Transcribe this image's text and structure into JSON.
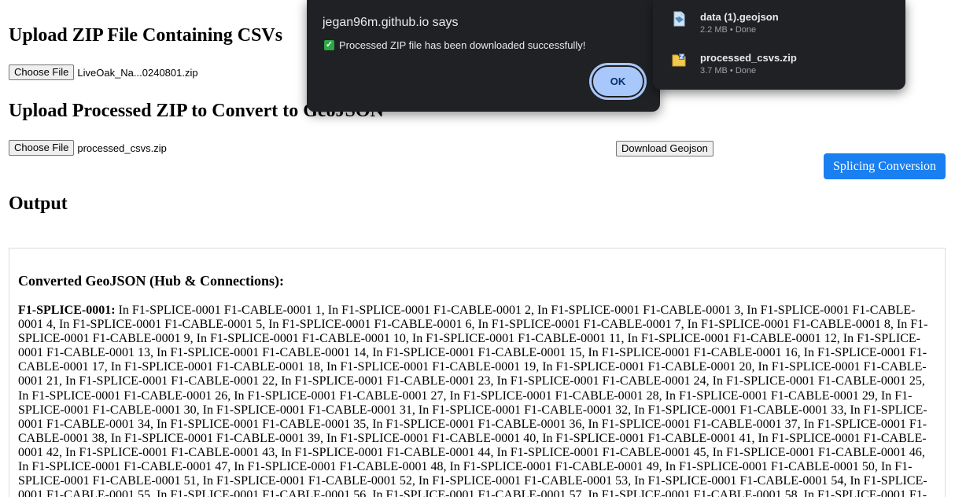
{
  "main": {
    "upload_heading": "Upload ZIP File Containing CSVs",
    "upload_choose_label": "Choose File",
    "upload_file_name": "LiveOak_Na...0240801.zip",
    "processed_heading": "Upload Processed ZIP to Convert to GeoJSON",
    "processed_choose_label": "Choose File",
    "processed_file_name": "processed_csvs.zip",
    "download_geojson_label": "Download Geojson",
    "splicing_label": "Splicing Conversion",
    "output_heading": "Output"
  },
  "output": {
    "title": "Converted GeoJSON (Hub & Connections):",
    "hub_label": "F1-SPLICE-0001:",
    "connections_text": " In F1-SPLICE-0001 F1-CABLE-0001 1, In F1-SPLICE-0001 F1-CABLE-0001 2, In F1-SPLICE-0001 F1-CABLE-0001 3, In F1-SPLICE-0001 F1-CABLE-0001 4, In F1-SPLICE-0001 F1-CABLE-0001 5, In F1-SPLICE-0001 F1-CABLE-0001 6, In F1-SPLICE-0001 F1-CABLE-0001 7, In F1-SPLICE-0001 F1-CABLE-0001 8, In F1-SPLICE-0001 F1-CABLE-0001 9, In F1-SPLICE-0001 F1-CABLE-0001 10, In F1-SPLICE-0001 F1-CABLE-0001 11, In F1-SPLICE-0001 F1-CABLE-0001 12, In F1-SPLICE-0001 F1-CABLE-0001 13, In F1-SPLICE-0001 F1-CABLE-0001 14, In F1-SPLICE-0001 F1-CABLE-0001 15, In F1-SPLICE-0001 F1-CABLE-0001 16, In F1-SPLICE-0001 F1-CABLE-0001 17, In F1-SPLICE-0001 F1-CABLE-0001 18, In F1-SPLICE-0001 F1-CABLE-0001 19, In F1-SPLICE-0001 F1-CABLE-0001 20, In F1-SPLICE-0001 F1-CABLE-0001 21, In F1-SPLICE-0001 F1-CABLE-0001 22, In F1-SPLICE-0001 F1-CABLE-0001 23, In F1-SPLICE-0001 F1-CABLE-0001 24, In F1-SPLICE-0001 F1-CABLE-0001 25, In F1-SPLICE-0001 F1-CABLE-0001 26, In F1-SPLICE-0001 F1-CABLE-0001 27, In F1-SPLICE-0001 F1-CABLE-0001 28, In F1-SPLICE-0001 F1-CABLE-0001 29, In F1-SPLICE-0001 F1-CABLE-0001 30, In F1-SPLICE-0001 F1-CABLE-0001 31, In F1-SPLICE-0001 F1-CABLE-0001 32, In F1-SPLICE-0001 F1-CABLE-0001 33, In F1-SPLICE-0001 F1-CABLE-0001 34, In F1-SPLICE-0001 F1-CABLE-0001 35, In F1-SPLICE-0001 F1-CABLE-0001 36, In F1-SPLICE-0001 F1-CABLE-0001 37, In F1-SPLICE-0001 F1-CABLE-0001 38, In F1-SPLICE-0001 F1-CABLE-0001 39, In F1-SPLICE-0001 F1-CABLE-0001 40, In F1-SPLICE-0001 F1-CABLE-0001 41, In F1-SPLICE-0001 F1-CABLE-0001 42, In F1-SPLICE-0001 F1-CABLE-0001 43, In F1-SPLICE-0001 F1-CABLE-0001 44, In F1-SPLICE-0001 F1-CABLE-0001 45, In F1-SPLICE-0001 F1-CABLE-0001 46, In F1-SPLICE-0001 F1-CABLE-0001 47, In F1-SPLICE-0001 F1-CABLE-0001 48, In F1-SPLICE-0001 F1-CABLE-0001 49, In F1-SPLICE-0001 F1-CABLE-0001 50, In F1-SPLICE-0001 F1-CABLE-0001 51, In F1-SPLICE-0001 F1-CABLE-0001 52, In F1-SPLICE-0001 F1-CABLE-0001 53, In F1-SPLICE-0001 F1-CABLE-0001 54, In F1-SPLICE-0001 F1-CABLE-0001 55, In F1-SPLICE-0001 F1-CABLE-0001 56, In F1-SPLICE-0001 F1-CABLE-0001 57, In F1-SPLICE-0001 F1-CABLE-0001 58, In F1-SPLICE-0001 F1-"
  },
  "alert": {
    "title": "jegan96m.github.io says",
    "message": "Processed ZIP file has been downloaded successfully!",
    "ok_label": "OK",
    "icon": "check-icon"
  },
  "downloads": {
    "items": [
      {
        "name": "data (1).geojson",
        "size": "2.2 MB",
        "status": "Done",
        "icon": "geojson-file-icon"
      },
      {
        "name": "processed_csvs.zip",
        "size": "3.7 MB",
        "status": "Done",
        "icon": "zip-file-icon"
      }
    ]
  },
  "colors": {
    "accent_button": "#1a7ff0",
    "dialog_bg": "#202124",
    "ok_button": "#a8c7fa",
    "check_green": "#29a845"
  }
}
